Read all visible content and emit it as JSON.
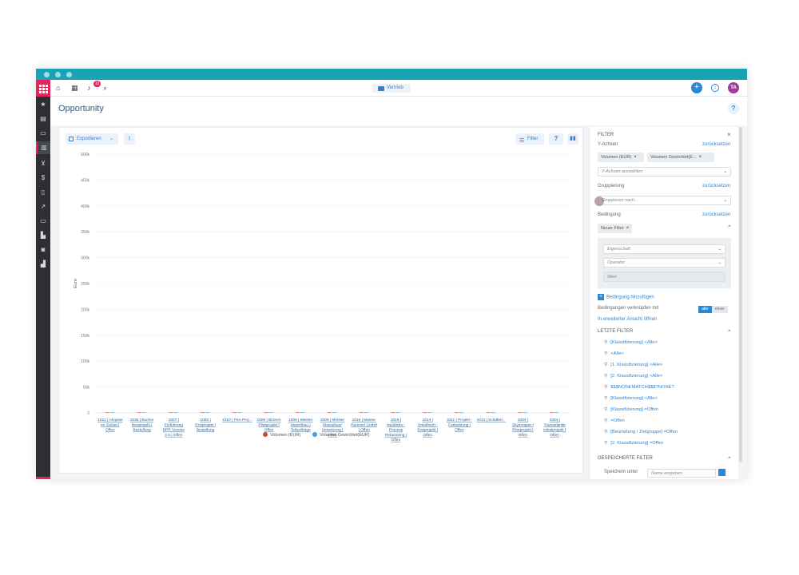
{
  "topnav": {
    "notification_count": "10",
    "app_chip": "Vertrieb",
    "plus": "+",
    "info": "i",
    "avatar_initials": "TA"
  },
  "page": {
    "title": "Opportunity",
    "help": "?"
  },
  "toolbar": {
    "export_label": "Exportieren",
    "more_label": "⋮",
    "filter_label": "Filter",
    "help_label": "?",
    "chart_label": "▮▮"
  },
  "chart_data": {
    "type": "bar",
    "ylabel": "Euro",
    "ylim": [
      0,
      500000
    ],
    "yticks": [
      "0",
      "50k",
      "100k",
      "150k",
      "200k",
      "250k",
      "300k",
      "350k",
      "400k",
      "450k",
      "500k"
    ],
    "categories": [
      [
        "1012 | Akquise",
        "im Gebiet |",
        "Offen"
      ],
      [
        "1036 | Bucher",
        "Neuprojekt |",
        "Bestellung"
      ],
      [
        "1007 |",
        "Einführung",
        "DPR Version",
        "2.5 | Offen"
      ],
      [
        "1082 |",
        "Erstprojekt |",
        "Bestellung"
      ],
      [
        "1010 | FSA Proj..."
      ],
      [
        "1005 | Bronen",
        "Pilotprojekt |",
        "Offen"
      ],
      [
        "1006 | Meister",
        "Maschbau |",
        "Teilaufträge"
      ],
      [
        "1009 | Meister",
        "Massebau/",
        "Umsetzung |",
        "Offen"
      ],
      [
        "1016 | Masse-",
        "Rummel GmbH",
        "| Offen"
      ],
      [
        "1015 |",
        "Neddicks -",
        "Process",
        "Refactoring |",
        "Offen"
      ],
      [
        "1014 |",
        "Omnifrech -",
        "Erstprojekt |",
        "Offen"
      ],
      [
        "1011 | Projekt -",
        "Fortsetzung |",
        "Offen"
      ],
      [
        "1013 | Schäferl..."
      ],
      [
        "1003 |",
        "Skyscraper /",
        "Pilotprojekt |",
        "Offen"
      ],
      [
        "1004 |",
        "Transatlantik",
        "Initialprojekt |",
        "Offen"
      ]
    ],
    "series": [
      {
        "name": "Volumen (EUR)",
        "color": "#d9433b",
        "values": [
          0,
          0,
          0,
          0,
          0,
          0,
          0,
          0,
          0,
          0,
          0,
          0,
          0,
          0,
          0
        ]
      },
      {
        "name": "Volumen Gewichtet(EUR)",
        "color": "#3a9ee8",
        "values": [
          0,
          0,
          0,
          0,
          0,
          0,
          0,
          0,
          0,
          0,
          0,
          0,
          0,
          0,
          0
        ]
      }
    ]
  },
  "filter": {
    "title": "FILTER",
    "close": "×",
    "y_axes_label": "Y-Achsen",
    "reset": "zurücksetzen",
    "y_chips": [
      "Volumen (EUR)",
      "Volumen Gewichtet(E..."
    ],
    "y_select_placeholder": "Y-Achsen auswählen",
    "grouping_label": "Gruppierung",
    "grouping_placeholder": "Gruppieren nach...",
    "condition_label": "Bedingung",
    "new_filter_chip": "Neuer Filter",
    "property_placeholder": "Eigenschaft",
    "operator_placeholder": "Operator",
    "value_placeholder": "Wert",
    "add_condition": "Bedingung hinzufügen",
    "link_conditions": "Bedingungen verknüpfen mit",
    "toggle_all": "alle",
    "toggle_one": "einer",
    "extended_view": "In erweiterter Ansicht öffnen",
    "recent_title": "LETZTE FILTER",
    "recent": [
      "[Klassifizierung] <Alle>",
      "<Alle>",
      "[1. Klassifizierung] <Alle>",
      "[2. Klassifizierung] <Alle>",
      "$$$NONEMATCH$$$?NONE?",
      "[Klassifizierung] <Alle>",
      "[Klassifizierung] =Offen",
      "=Offen",
      "[Beurteilung / Zielgruppe] =Offen",
      "[2. Klassifizierung] =Offen"
    ],
    "saved_title": "GESPEICHERTE FILTER",
    "save_under": "Speichern unter",
    "name_placeholder": "Name eingeben"
  }
}
